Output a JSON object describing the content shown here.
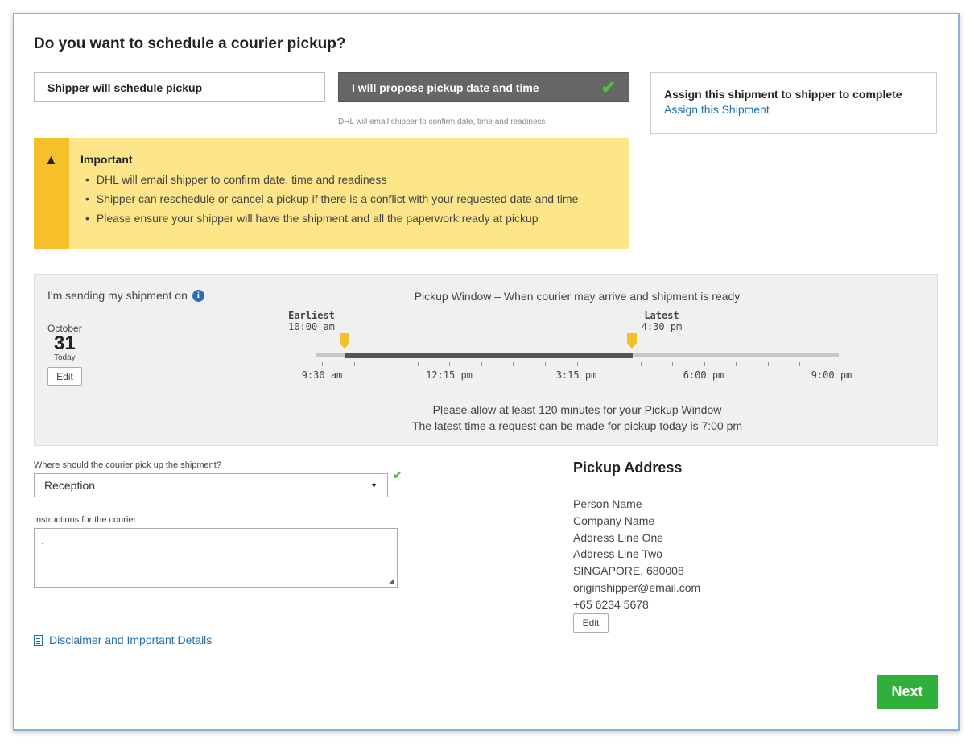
{
  "header": {
    "title": "Do you want to schedule a courier pickup?"
  },
  "options": {
    "shipper_schedule": "Shipper will schedule pickup",
    "propose": "I will propose pickup date and time",
    "propose_note": "DHL will email shipper to confirm date, time and readiness"
  },
  "assign": {
    "title": "Assign this shipment to shipper to complete",
    "link": "Assign this Shipment"
  },
  "important": {
    "title": "Important",
    "items": [
      "DHL will email shipper to confirm date, time and readiness",
      "Shipper can reschedule or cancel a pickup if there is a conflict with your requested date and time",
      "Please ensure your shipper will have the shipment and all the paperwork ready at pickup"
    ]
  },
  "schedule": {
    "sending_label": "I'm sending my shipment on",
    "month": "October",
    "day": "31",
    "day_note": "Today",
    "edit_label": "Edit",
    "window_title": "Pickup Window – When courier may arrive and shipment is ready",
    "earliest_label": "Earliest",
    "earliest_time": "10:00 am",
    "latest_label": "Latest",
    "latest_time": "4:30 pm",
    "timeline_labels": [
      "9:30 am",
      "12:15 pm",
      "3:15 pm",
      "6:00 pm",
      "9:00 pm"
    ],
    "allow_note": "Please allow at least 120 minutes for your Pickup Window",
    "latest_request_note": "The latest time a request can be made for pickup today is 7:00 pm"
  },
  "pickup_location": {
    "label": "Where should the courier pick up the shipment?",
    "value": "Reception"
  },
  "instructions": {
    "label": "Instructions for the courier",
    "value": "."
  },
  "disclaimer": "Disclaimer and Important Details",
  "address": {
    "title": "Pickup Address",
    "person": "Person Name",
    "company": "Company Name",
    "line1": "Address Line One",
    "line2": "Address Line Two",
    "city": "SINGAPORE, 680008",
    "email": "originshipper@email.com",
    "phone": "+65 6234 5678",
    "edit_label": "Edit"
  },
  "footer": {
    "next_label": "Next"
  },
  "colors": {
    "accent_yellow": "#f6c02a",
    "important_bg": "#fde58a",
    "selected_option": "#666666",
    "next_green": "#2eb03a",
    "link_blue": "#1f6fad"
  }
}
